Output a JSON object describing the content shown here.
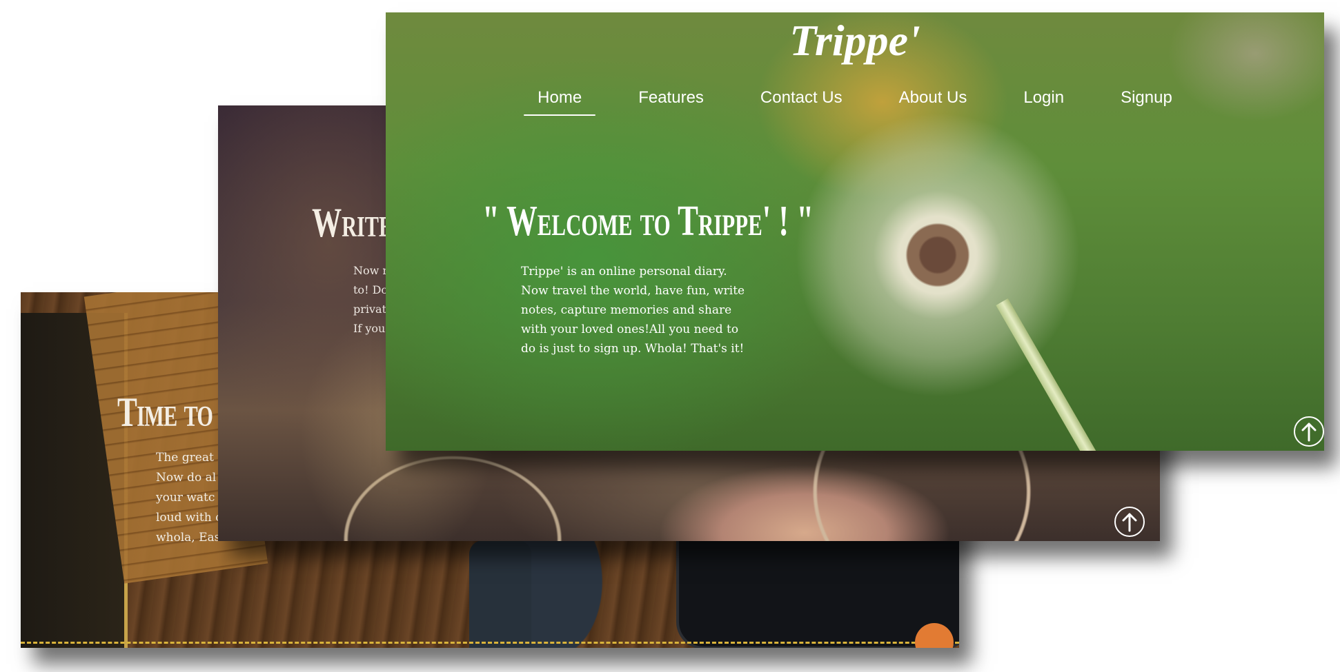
{
  "back_card": {
    "title": "Time to u",
    "text": "The great\nNow do al\nyour watc\nloud with o\nwhola, Eas"
  },
  "middle_card": {
    "title": "Write a",
    "text": "Now m\nto! Do\nprivat\nIf you"
  },
  "front_card": {
    "logo": "Trippe'",
    "nav": [
      {
        "label": "Home",
        "active": true
      },
      {
        "label": "Features"
      },
      {
        "label": "Contact Us"
      },
      {
        "label": "About Us"
      },
      {
        "label": "Login"
      },
      {
        "label": "Signup"
      }
    ],
    "hero_title": "\" Welcome to Trippe' ! \"",
    "hero_text": "Trippe' is an online personal diary. Now travel the world, have fun, write notes, capture memories and share with your loved ones!All you need to do is just to sign up. Whola! That's it!"
  },
  "icons": {
    "scroll_up": "arrow-up-circle-icon",
    "back_scroll_up": "arrow-up-circle-icon"
  },
  "colors": {
    "back_scroll_accent": "#e27b33",
    "dashed_line": "#d9b33a"
  }
}
